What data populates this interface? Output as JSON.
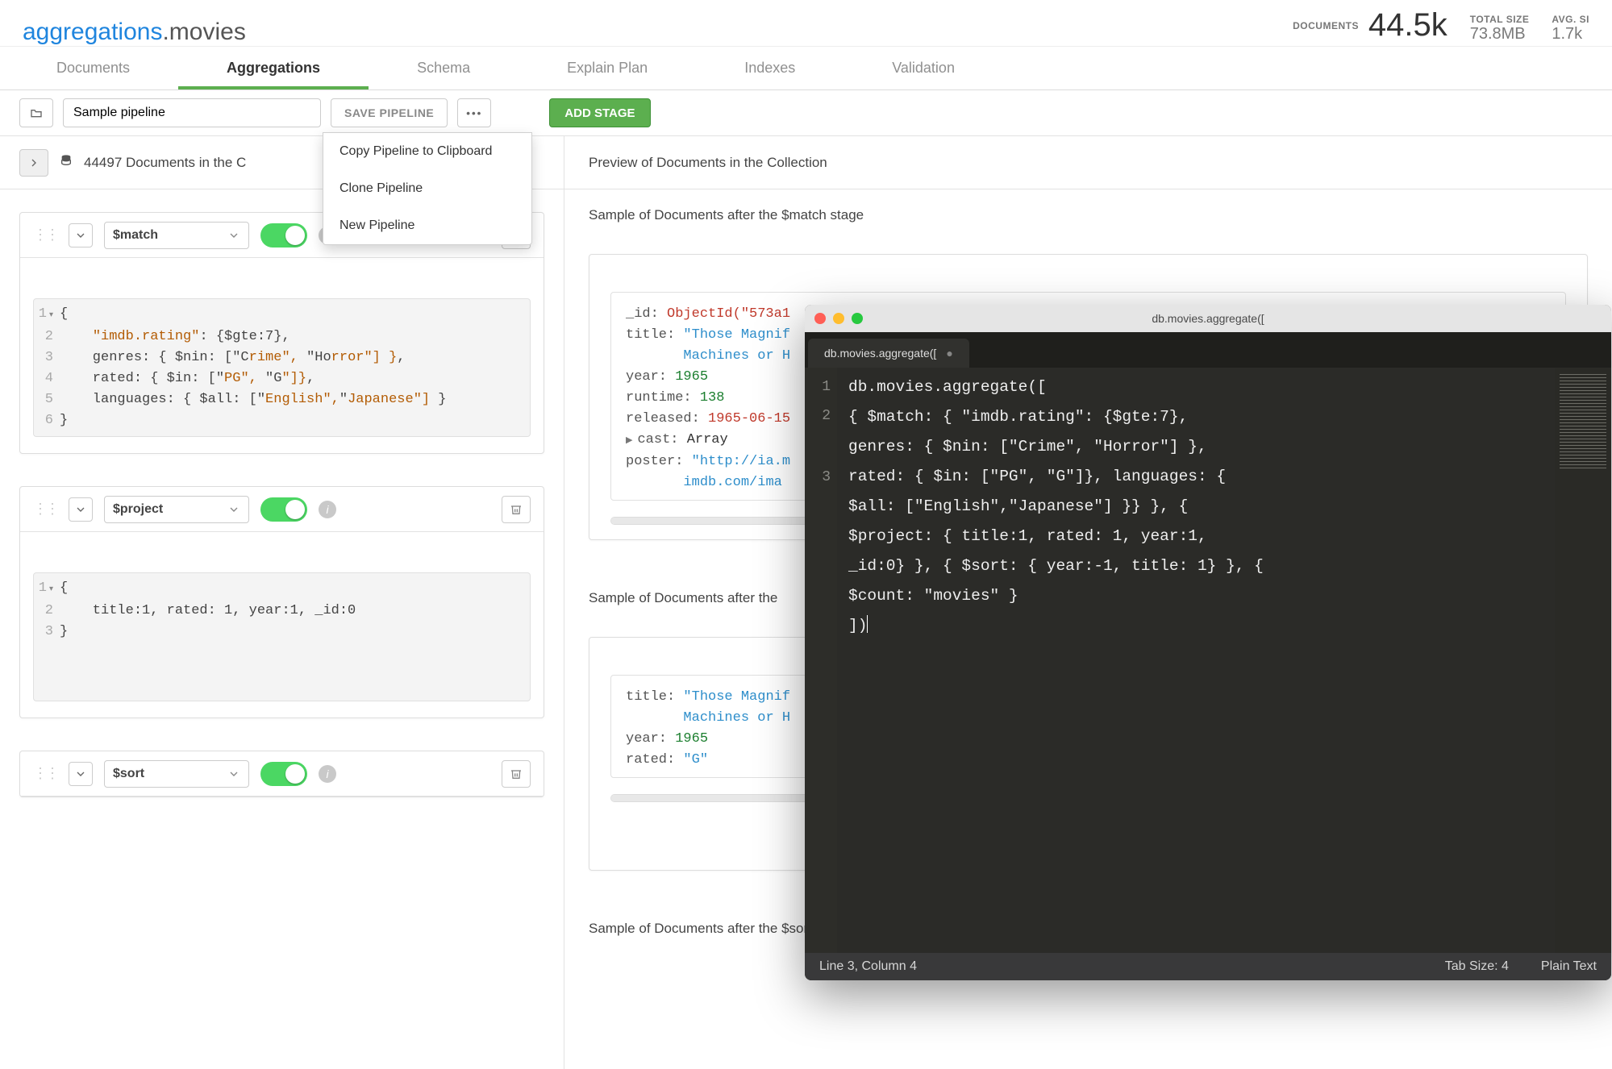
{
  "breadcrumb": {
    "db": "aggregations",
    "coll": ".movies"
  },
  "stats": {
    "documents_label": "DOCUMENTS",
    "documents_value": "44.5k",
    "totalsize_label": "TOTAL SIZE",
    "totalsize_value": "73.8MB",
    "avgsize_label": "AVG. SI",
    "avgsize_value": "1.7k"
  },
  "tabs": [
    "Documents",
    "Aggregations",
    "Schema",
    "Explain Plan",
    "Indexes",
    "Validation"
  ],
  "active_tab": "Aggregations",
  "toolbar": {
    "pipeline_name_placeholder": "Sample pipeline",
    "save": "SAVE PIPELINE",
    "add_stage": "ADD STAGE"
  },
  "dropdown_items": [
    "Copy Pipeline to Clipboard",
    "Clone Pipeline",
    "New Pipeline"
  ],
  "doc_count_text": "44497 Documents in the C",
  "preview_header": "Preview of Documents in the Collection",
  "stages": [
    {
      "operator": "$match",
      "preview_label": "Sample of Documents after the $match stage",
      "code_lines": [
        {
          "n": "1",
          "fold": "▾",
          "t": "{"
        },
        {
          "n": "2",
          "t": "    \"imdb.rating\": {$gte:7},",
          "hl": [
            [
              4,
              17,
              "str"
            ]
          ]
        },
        {
          "n": "3",
          "t": "    genres: { $nin: [\"Crime\", \"Horror\"] },",
          "hl": [
            [
              23,
              30,
              "str"
            ],
            [
              33,
              41,
              "str"
            ]
          ]
        },
        {
          "n": "4",
          "t": "    rated: { $in: [\"PG\", \"G\"]},",
          "hl": [
            [
              20,
              24,
              "str"
            ],
            [
              27,
              30,
              "str"
            ]
          ]
        },
        {
          "n": "5",
          "t": "    languages: { $all: [\"English\",\"Japanese\"] }",
          "hl": [
            [
              25,
              34,
              "str"
            ],
            [
              35,
              45,
              "str"
            ]
          ]
        },
        {
          "n": "6",
          "t": "}"
        }
      ],
      "doc": {
        "lines": [
          {
            "k": "_id:",
            "vclass": "oid",
            "v": "ObjectId(\"573a1"
          },
          {
            "k": "title:",
            "vclass": "strv",
            "v": "\"Those Magnif"
          },
          {
            "cont": true,
            "vclass": "strv",
            "v": "Machines or H"
          },
          {
            "k": "year:",
            "vclass": "num",
            "v": "1965"
          },
          {
            "k": "runtime:",
            "vclass": "num",
            "v": "138"
          },
          {
            "k": "released:",
            "vclass": "oid",
            "v": "1965-06-15"
          },
          {
            "tri": "▶",
            "k": "cast:",
            "v": "Array"
          },
          {
            "k": "poster:",
            "vclass": "strv",
            "v": "\"http://ia.m"
          },
          {
            "cont": true,
            "vclass": "strv",
            "v": "imdb.com/ima"
          }
        ]
      }
    },
    {
      "operator": "$project",
      "preview_label": "Sample of Documents after the",
      "code_lines": [
        {
          "n": "1",
          "fold": "▾",
          "t": "{"
        },
        {
          "n": "2",
          "t": "    title:1, rated: 1, year:1, _id:0"
        },
        {
          "n": "3",
          "t": "}"
        }
      ],
      "doc": {
        "lines": [
          {
            "k": "title:",
            "vclass": "strv",
            "v": "\"Those Magnif"
          },
          {
            "cont": true,
            "vclass": "strv",
            "v": "Machines or H"
          },
          {
            "k": "year:",
            "vclass": "num",
            "v": "1965"
          },
          {
            "k": "rated:",
            "vclass": "strv",
            "v": "\"G\""
          }
        ]
      }
    },
    {
      "operator": "$sort",
      "preview_label": "Sample of Documents after the $sort stage"
    }
  ],
  "code_window": {
    "title": "db.movies.aggregate([",
    "tab": "db.movies.aggregate([",
    "gutter": [
      "1",
      "2",
      "",
      "",
      "",
      "",
      "",
      "3"
    ],
    "lines": [
      "db.movies.aggregate([",
      "  { $match: {  \"imdb.rating\": {$gte:7},",
      "  genres: { $nin: [\"Crime\", \"Horror\"] },",
      "  rated: { $in: [\"PG\", \"G\"]},  languages: {",
      "  $all: [\"English\",\"Japanese\"] }} }, {",
      "  $project: {  title:1, rated: 1, year:1,",
      "  _id:0} }, { $sort: {  year:-1, title: 1} }, {",
      "  $count: \"movies\" }",
      "  ])"
    ],
    "status_left": "Line 3, Column 4",
    "status_tab": "Tab Size: 4",
    "status_right": "Plain Text"
  }
}
